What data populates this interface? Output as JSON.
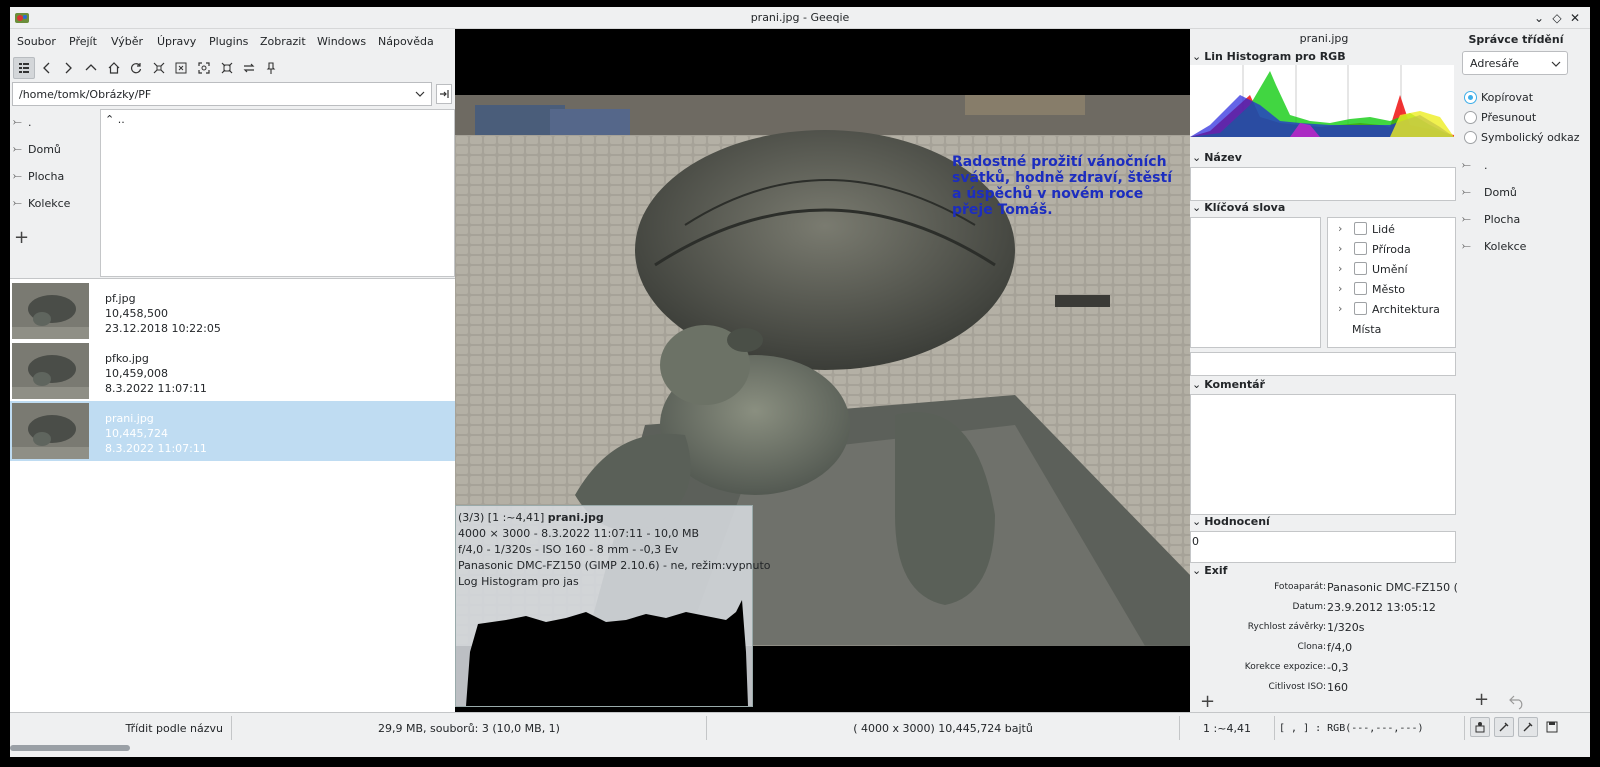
{
  "window": {
    "title": "prani.jpg - Geeqie"
  },
  "menu": [
    "Soubor",
    "Přejít",
    "Výběr",
    "Úpravy",
    "Plugins",
    "Zobrazit",
    "Windows",
    "Nápověda"
  ],
  "toolbar": {
    "icons": [
      "list-view-icon",
      "back-icon",
      "forward-icon",
      "up-icon",
      "home-icon",
      "refresh-icon",
      "zoom-in-icon",
      "zoom-out-icon",
      "zoom-fit-icon",
      "zoom-100-icon",
      "swap-icon",
      "pin-icon"
    ]
  },
  "path": {
    "value": "/home/tomk/Obrázky/PF"
  },
  "bookmarks": [
    ".",
    "Domů",
    "Plocha",
    "Kolekce"
  ],
  "dirlist": [
    ".."
  ],
  "files": [
    {
      "name": "pf.jpg",
      "size": "10,458,500",
      "date": "23.12.2018 10:22:05",
      "selected": false
    },
    {
      "name": "pfko.jpg",
      "size": "10,459,008",
      "date": "8.3.2022 11:07:11",
      "selected": false
    },
    {
      "name": "prani.jpg",
      "size": "10,445,724",
      "date": "8.3.2022 11:07:11",
      "selected": true
    }
  ],
  "image": {
    "overlay_text": [
      "Radostné prožití vánočních",
      "svátků, hodně zdraví, štěstí",
      "a úspěchů v novém roce",
      "přeje Tomáš."
    ]
  },
  "osd": {
    "line1_prefix": "(3/3) [1 :~4,41] ",
    "line1_name": "prani.jpg",
    "line2": "4000 × 3000 - 8.3.2022 11:07:11 - 10,0 MB",
    "line3": "f/4,0 - 1/320s - ISO 160 - 8 mm - -0,3 Ev",
    "line4": "Panasonic DMC-FZ150 (GIMP 2.10.6) - ne, režim:vypnuto",
    "line5": "Log Histogram pro jas"
  },
  "info": {
    "title": "prani.jpg",
    "hist_label": "Lin Histogram pro RGB",
    "name_label": "Název",
    "keywords_label": "Klíčová slova",
    "keywords": [
      "Lidé",
      "Příroda",
      "Umění",
      "Město",
      "Architektura"
    ],
    "keywords_extra": "Místa",
    "comment_label": "Komentář",
    "rating_label": "Hodnocení",
    "rating_value": "0",
    "exif_label": "Exif",
    "exif": [
      {
        "k": "Fotoaparát:",
        "v": "Panasonic DMC-FZ150 (..."
      },
      {
        "k": "Datum:",
        "v": "23.9.2012 13:05:12"
      },
      {
        "k": "Rychlost závěrky:",
        "v": "1/320s"
      },
      {
        "k": "Clona:",
        "v": "f/4,0"
      },
      {
        "k": "Korekce expozice:",
        "v": "-0,3"
      },
      {
        "k": "Citlivost ISO:",
        "v": "160"
      }
    ]
  },
  "sort": {
    "title": "Správce třídění",
    "mode": "Adresáře",
    "actions": [
      {
        "label": "Kopírovat",
        "on": true
      },
      {
        "label": "Přesunout",
        "on": false
      },
      {
        "label": "Symbolický odkaz",
        "on": false
      }
    ],
    "items": [
      ".",
      "Domů",
      "Plocha",
      "Kolekce"
    ]
  },
  "status": {
    "sort": "Třídit podle názvu",
    "summary": "29,9 MB, souborů: 3 (10,0 MB, 1)",
    "image": "( 4000 x 3000) 10,445,724 bajtů",
    "zoom": "1 :~4,41",
    "pixel": "[ , ] : RGB(---,---,---)"
  }
}
